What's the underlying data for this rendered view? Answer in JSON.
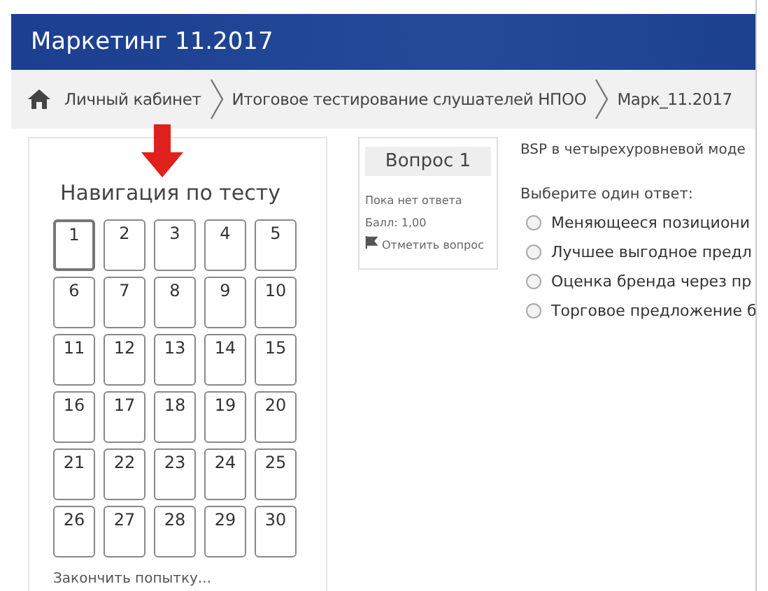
{
  "header": {
    "title": "Маркетинг 11.2017"
  },
  "breadcrumb": [
    "Личный кабинет",
    "Итоговое тестирование слушателей НПОО",
    "Марк_11.2017"
  ],
  "navigation": {
    "title": "Навигация по тесту",
    "questions": [
      {
        "label": "1",
        "selected": true
      },
      {
        "label": "2",
        "selected": false
      },
      {
        "label": "3",
        "selected": false
      },
      {
        "label": "4",
        "selected": false
      },
      {
        "label": "5",
        "selected": false
      },
      {
        "label": "6",
        "selected": false
      },
      {
        "label": "7",
        "selected": false
      },
      {
        "label": "8",
        "selected": false
      },
      {
        "label": "9",
        "selected": false
      },
      {
        "label": "10",
        "selected": false
      },
      {
        "label": "11",
        "selected": false
      },
      {
        "label": "12",
        "selected": false
      },
      {
        "label": "13",
        "selected": false
      },
      {
        "label": "14",
        "selected": false
      },
      {
        "label": "15",
        "selected": false
      },
      {
        "label": "16",
        "selected": false
      },
      {
        "label": "17",
        "selected": false
      },
      {
        "label": "18",
        "selected": false
      },
      {
        "label": "19",
        "selected": false
      },
      {
        "label": "20",
        "selected": false
      },
      {
        "label": "21",
        "selected": false
      },
      {
        "label": "22",
        "selected": false
      },
      {
        "label": "23",
        "selected": false
      },
      {
        "label": "24",
        "selected": false
      },
      {
        "label": "25",
        "selected": false
      },
      {
        "label": "26",
        "selected": false
      },
      {
        "label": "27",
        "selected": false
      },
      {
        "label": "28",
        "selected": false
      },
      {
        "label": "29",
        "selected": false
      },
      {
        "label": "30",
        "selected": false
      }
    ],
    "finish_link": "Закончить попытку..."
  },
  "question_info": {
    "title": "Вопрос 1",
    "status": "Пока нет ответа",
    "score": "Балл: 1,00",
    "flag": "Отметить вопрос"
  },
  "question": {
    "text": "BSP в четырехуровневой моде",
    "prompt": "Выберите один ответ:",
    "options": [
      {
        "label": "Меняющееся позициони",
        "selected": false
      },
      {
        "label": "Лучшее выгодное предл",
        "selected": false
      },
      {
        "label": "Оценка бренда через пр",
        "selected": false
      },
      {
        "label": "Торговое предложение б",
        "selected": false
      }
    ]
  }
}
